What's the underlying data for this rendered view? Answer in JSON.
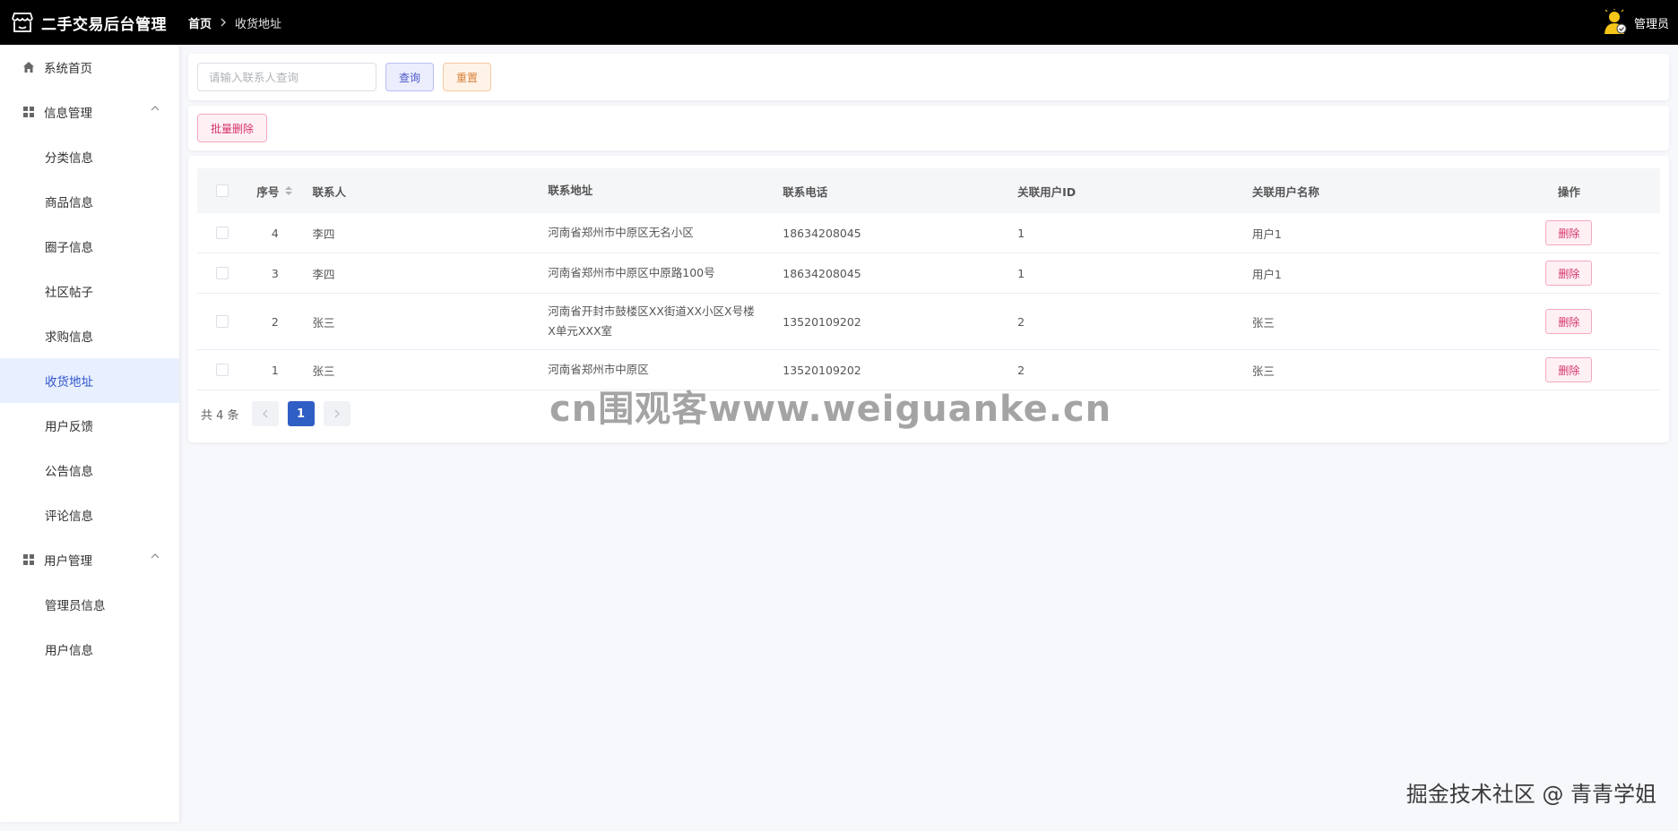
{
  "app": {
    "title": "二手交易后台管理"
  },
  "breadcrumb": {
    "home": "首页",
    "current": "收货地址"
  },
  "user": {
    "name": "管理员"
  },
  "sidebar": {
    "home": "系统首页",
    "groups": [
      {
        "label": "信息管理",
        "items": [
          "分类信息",
          "商品信息",
          "圈子信息",
          "社区帖子",
          "求购信息",
          "收货地址",
          "用户反馈",
          "公告信息",
          "评论信息"
        ]
      },
      {
        "label": "用户管理",
        "items": [
          "管理员信息",
          "用户信息"
        ]
      }
    ],
    "active": "收货地址"
  },
  "search": {
    "placeholder": "请输入联系人查询",
    "value": "",
    "query_label": "查询",
    "reset_label": "重置"
  },
  "toolbar": {
    "batch_delete_label": "批量删除"
  },
  "table": {
    "headers": {
      "seq": "序号",
      "contact": "联系人",
      "address": "联系地址",
      "phone": "联系电话",
      "uid": "关联用户ID",
      "uname": "关联用户名称",
      "action": "操作"
    },
    "rows": [
      {
        "seq": "4",
        "contact": "李四",
        "address": "河南省郑州市中原区无名小区",
        "phone": "18634208045",
        "uid": "1",
        "uname": "用户1"
      },
      {
        "seq": "3",
        "contact": "李四",
        "address": "河南省郑州市中原区中原路100号",
        "phone": "18634208045",
        "uid": "1",
        "uname": "用户1"
      },
      {
        "seq": "2",
        "contact": "张三",
        "address": "河南省开封市鼓楼区XX街道XX小区X号楼X单元XXX室",
        "phone": "13520109202",
        "uid": "2",
        "uname": "张三"
      },
      {
        "seq": "1",
        "contact": "张三",
        "address": "河南省郑州市中原区",
        "phone": "13520109202",
        "uid": "2",
        "uname": "张三"
      }
    ],
    "delete_label": "删除"
  },
  "pagination": {
    "total_text": "共 4 条",
    "current_page": "1"
  },
  "watermark": {
    "text": "cn围观客www.weiguanke.cn"
  },
  "footer": {
    "text": "掘金技术社区 @ 青青学姐"
  },
  "colors": {
    "topbar": "#000000",
    "active_menu_bg": "#e8f0ff",
    "active_menu_text": "#2f54c9",
    "page_active": "#2f5ec4",
    "delete_accent": "#d4336b"
  }
}
